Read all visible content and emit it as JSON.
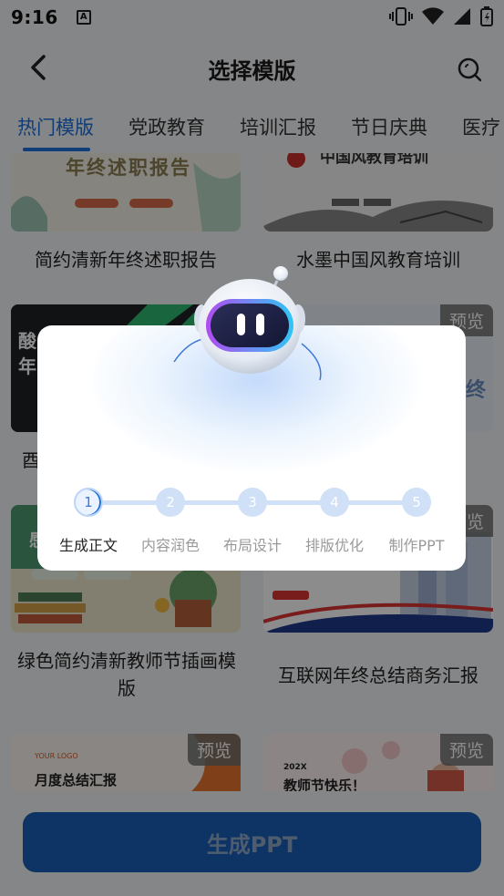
{
  "status": {
    "time": "9:16",
    "notif_letter": "A"
  },
  "nav": {
    "title": "选择模版"
  },
  "tabs": [
    {
      "label": "热门模版",
      "active": true
    },
    {
      "label": "党政教育",
      "active": false
    },
    {
      "label": "培训汇报",
      "active": false
    },
    {
      "label": "节日庆典",
      "active": false
    },
    {
      "label": "医疗",
      "active": false
    }
  ],
  "templates": [
    {
      "title": "简约清新年终述职报告",
      "thumb_text": "年终述职报告",
      "preview": ""
    },
    {
      "title": "水墨中国风教育培训",
      "thumb_text": "中国风教育培训",
      "preview": ""
    },
    {
      "title": "酉",
      "thumb_text": "酸",
      "thumb_text2": "年",
      "preview": ""
    },
    {
      "title": "",
      "thumb_text": "年终",
      "preview": "预览"
    },
    {
      "title_line1": "绿色简约清新教师节插画模",
      "title_line2": "版",
      "thumb_text": "感",
      "preview": ""
    },
    {
      "title": "互联网年终总结商务汇报",
      "preview": "预览"
    },
    {
      "title": "",
      "thumb_text": "月度总结汇报",
      "logo": "YOUR LOGO",
      "preview": "预览"
    },
    {
      "title": "",
      "thumb_text": "教师节快乐！",
      "year": "202X",
      "preview": "预览"
    }
  ],
  "dialog": {
    "steps": [
      {
        "num": "1",
        "label": "生成正文",
        "active": true
      },
      {
        "num": "2",
        "label": "内容润色",
        "active": false
      },
      {
        "num": "3",
        "label": "布局设计",
        "active": false
      },
      {
        "num": "4",
        "label": "排版优化",
        "active": false
      },
      {
        "num": "5",
        "label": "制作PPT",
        "active": false
      }
    ]
  },
  "bottom_button": {
    "label": "生成PPT"
  },
  "colors": {
    "accent": "#1e6fd9",
    "button": "#1a5fb8",
    "overlay": "rgba(0,0,0,0.45)"
  }
}
